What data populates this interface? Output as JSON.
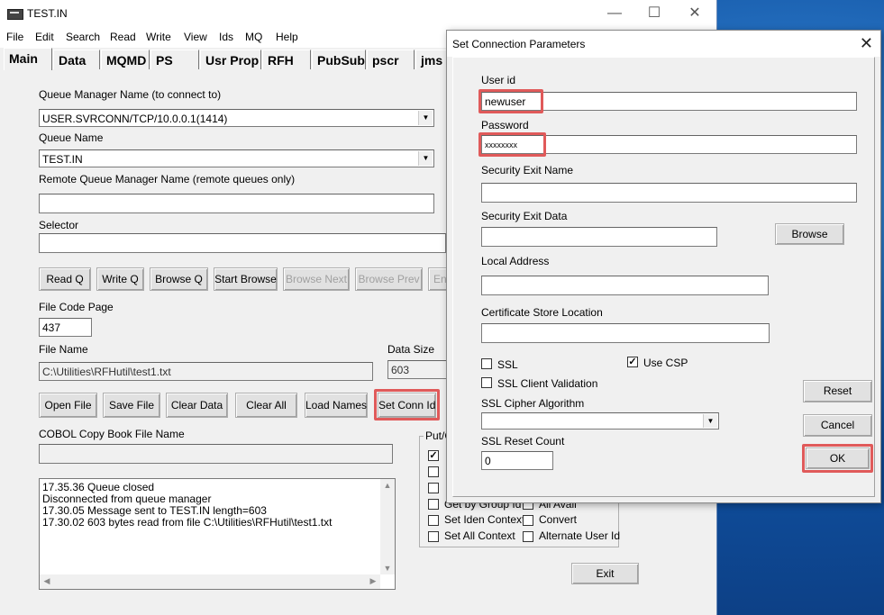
{
  "window": {
    "title": "TEST.IN"
  },
  "menu": [
    "File",
    "Edit",
    "Search",
    "Read",
    "Write",
    "View",
    "Ids",
    "MQ",
    "Help"
  ],
  "tabs": [
    "Main",
    "Data",
    "MQMD",
    "PS",
    "Usr Prop",
    "RFH",
    "PubSub",
    "pscr",
    "jms"
  ],
  "main": {
    "qm_label": "Queue Manager Name (to connect to)",
    "qm_value": "USER.SVRCONN/TCP/10.0.0.1(1414)",
    "queue_label": "Queue Name",
    "queue_value": "TEST.IN",
    "remote_qm_label": "Remote Queue Manager Name (remote queues only)",
    "remote_qm_value": "",
    "selector_label": "Selector",
    "selector_value": "",
    "buttons_row1": {
      "read_q": "Read Q",
      "write_q": "Write Q",
      "browse_q": "Browse Q",
      "start_browse": "Start Browse",
      "browse_next": "Browse Next",
      "browse_prev": "Browse Prev",
      "end": "End"
    },
    "file_code_page_label": "File Code Page",
    "file_code_page_value": "437",
    "file_name_label": "File Name",
    "file_name_value": "C:\\Utilities\\RFHutil\\test1.txt",
    "data_size_label": "Data Size",
    "data_size_value": "603",
    "buttons_row2": {
      "open_file": "Open File",
      "save_file": "Save File",
      "clear_data": "Clear Data",
      "clear_all": "Clear All",
      "load_names": "Load Names",
      "set_conn_id": "Set Conn Id"
    },
    "cobol_label": "COBOL Copy Book File Name",
    "cobol_value": "",
    "log_lines": [
      "17.35.36 Queue closed",
      "Disconnected from queue manager",
      "17.30.05 Message sent to TEST.IN length=603",
      "17.30.02 603 bytes read from file C:\\Utilities\\RFHutil\\test1.txt"
    ],
    "put_get_group_label": "Put/G",
    "options": {
      "get_by_group_id": "Get by Group Id",
      "all_avail": "All Avail",
      "set_iden_context": "Set Iden Context",
      "convert": "Convert",
      "set_all_context": "Set All Context",
      "alternate_user_id": "Alternate User Id"
    },
    "exit_button": "Exit"
  },
  "dialog": {
    "title": "Set Connection Parameters",
    "user_id_label": "User id",
    "user_id_value": "newuser",
    "password_label": "Password",
    "password_value": "xxxxxxxx",
    "sec_exit_name_label": "Security Exit Name",
    "sec_exit_name_value": "",
    "sec_exit_data_label": "Security Exit Data",
    "sec_exit_data_value": "",
    "browse_button": "Browse",
    "local_address_label": "Local Address",
    "local_address_value": "",
    "cert_store_label": "Certificate Store Location",
    "cert_store_value": "",
    "ssl_label": "SSL",
    "ssl_checked": false,
    "use_csp_label": "Use CSP",
    "use_csp_checked": true,
    "ssl_client_validation_label": "SSL Client Validation",
    "ssl_client_validation_checked": false,
    "ssl_cipher_label": "SSL Cipher Algorithm",
    "ssl_cipher_value": "",
    "ssl_reset_count_label": "SSL Reset Count",
    "ssl_reset_count_value": "0",
    "reset_button": "Reset",
    "cancel_button": "Cancel",
    "ok_button": "OK"
  },
  "colors": {
    "highlight": "#e05a5a",
    "desktop": "#0f4f9e"
  }
}
